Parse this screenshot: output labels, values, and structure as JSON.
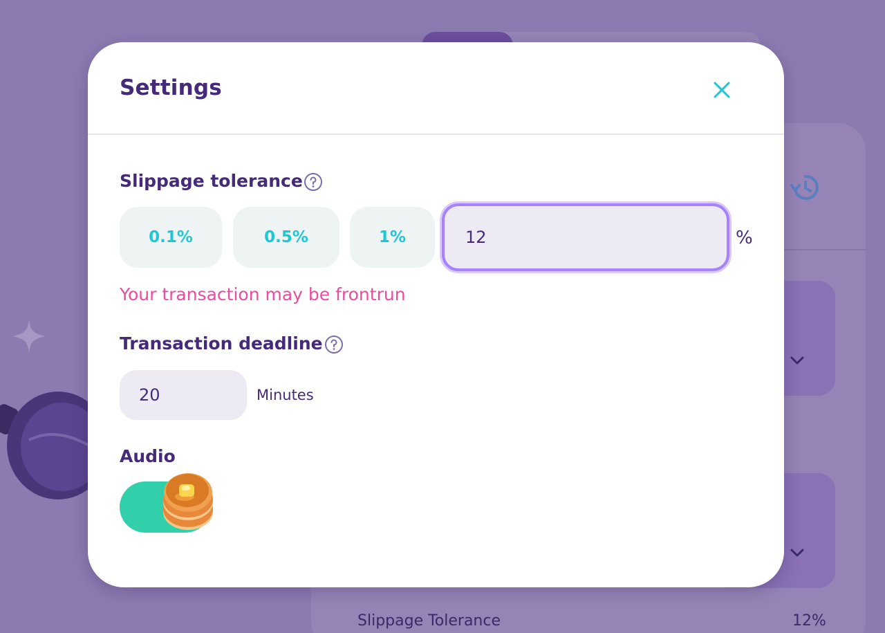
{
  "background": {
    "swap_settings": {
      "slippage_label": "Slippage Tolerance",
      "slippage_value": "12%"
    }
  },
  "modal": {
    "title": "Settings",
    "slippage": {
      "label": "Slippage tolerance",
      "presets": [
        "0.1%",
        "0.5%",
        "1%"
      ],
      "custom_value": "12",
      "unit": "%",
      "warning": "Your transaction may be frontrun"
    },
    "deadline": {
      "label": "Transaction deadline",
      "value": "20",
      "unit": "Minutes"
    },
    "audio": {
      "label": "Audio",
      "enabled": true
    }
  },
  "colors": {
    "primary_text": "#452a7a",
    "accent_cyan": "#1fc7d4",
    "warning_pink": "#ed4b9e",
    "toggle_on": "#31d0aa",
    "input_focus": "#a881fc",
    "backdrop": "#8c7bb0"
  },
  "icons": [
    "close-icon",
    "help-icon",
    "history-icon",
    "chevron-down-icon",
    "pancake-icon",
    "sparkle-icon",
    "frying-pan-icon"
  ]
}
